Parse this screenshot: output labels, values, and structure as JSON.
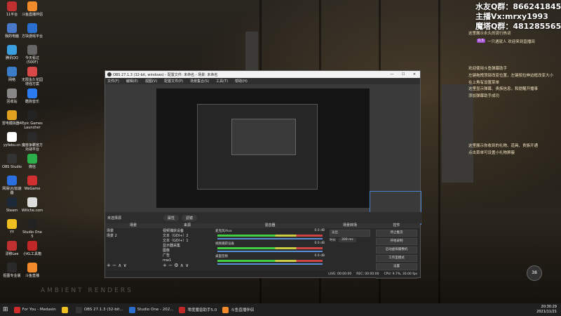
{
  "desktop_icons": [
    {
      "label": "11平台",
      "color": "#c03030"
    },
    {
      "label": "我的电脑",
      "color": "#4a78c8"
    },
    {
      "label": "腾讯QQ",
      "color": "#3aa0e0"
    },
    {
      "label": "网络",
      "color": "#3b7dc9"
    },
    {
      "label": "回收站",
      "color": "#888888"
    },
    {
      "label": "雷电模拟器4",
      "color": "#e0a020"
    },
    {
      "label": "yyfabu.cn",
      "color": "#ffffff"
    },
    {
      "label": "OBS Studio",
      "color": "#333333"
    },
    {
      "label": "网易UU加速器",
      "color": "#2b6ee0"
    },
    {
      "label": "Steam",
      "color": "#1b2838"
    },
    {
      "label": "YY",
      "color": "#f0c020"
    },
    {
      "label": "漂移Lee",
      "color": "#c03030"
    },
    {
      "label": "抠图专业版",
      "color": "#2a2a2a"
    },
    {
      "label": "斗鱼直播伴侣",
      "color": "#f08a2a"
    },
    {
      "label": "方块游戏平台",
      "color": "#2a6fd0"
    },
    {
      "label": "今天看过(500F)",
      "color": "#666666"
    },
    {
      "label": "无限永久花园增强方案",
      "color": "#d84848"
    },
    {
      "label": "酷狗音乐",
      "color": "#2a7cf0"
    },
    {
      "label": "Epic Games Launcher",
      "color": "#222222"
    },
    {
      "label": "魔兽争霸官方对战平台",
      "color": "#2a2a2a"
    },
    {
      "label": "微信",
      "color": "#2aaf4a"
    },
    {
      "label": "WeGame",
      "color": "#d03030"
    },
    {
      "label": "Wiliche.com",
      "color": "#dddddd"
    },
    {
      "label": "Studio One 5",
      "color": "#222222"
    },
    {
      "label": "小KL工具箱",
      "color": "#c02828"
    },
    {
      "label": "斗鱼直播",
      "color": "#f08a2a"
    }
  ],
  "overlay": {
    "line1": "水友Q群：866241845",
    "line2": "主播Vx:mrxy1993",
    "line3": "魔塔Q群：481285565",
    "chat": [
      "这里展示永久的流行热词",
      "一只遇就人  欢迎来到直播间",
      "欢迎使用斗鱼弹幕助手",
      "左键拖拽顶部改变位置，左键按拉伸边框改变大小",
      "在上角有设置菜单",
      "这里显示弹幕、贵族信息，和提醒开播事",
      "添加弹幕助手成功",
      "这里展示你收到的礼物、道具、贵族开通",
      "点击菜单可设置小礼物屏蔽"
    ],
    "badge": "0.5"
  },
  "obs": {
    "title": "OBS 27.1.3 (32-bit, windows) - 配置文件: 未命名 - 场景: 未命名",
    "menu": [
      "文件(F)",
      "编辑(E)",
      "视图(V)",
      "配置文件(P)",
      "场景集合(S)",
      "工具(T)",
      "帮助(H)"
    ],
    "preview_label": "未选择源",
    "properties_btn": "属性",
    "filters_btn": "滤镜",
    "docks": {
      "scenes": {
        "title": "场景",
        "items": [
          "场景",
          "场景 2"
        ]
      },
      "sources": {
        "title": "来源",
        "items": [
          "视频捕获设备",
          "文本（GDI+）2",
          "文本（GDI+）1",
          "显示器采集",
          "图像",
          "广告",
          "mw1"
        ]
      },
      "mixer": {
        "title": "混音器",
        "channels": [
          {
            "name": "麦克风/Aux",
            "level": "0.0 dB"
          },
          {
            "name": "视频捕获设备",
            "level": "0.0 dB"
          },
          {
            "name": "桌面音频",
            "level": "0.0 dB"
          }
        ]
      },
      "transitions": {
        "title": "场景转场",
        "type": "淡出",
        "duration_label": "时长",
        "duration": "300 ms"
      },
      "controls": {
        "title": "控件",
        "buttons": [
          "停止推流",
          "开始录制",
          "启动虚拟摄像机",
          "工作室模式",
          "设置",
          "退出"
        ]
      }
    },
    "status": {
      "live": "LIVE: 00:00:00",
      "rec": "REC: 00:00:00",
      "cpu": "CPU: 9.7%, 30.00 fps"
    }
  },
  "taskbar": {
    "items": [
      {
        "label": "For You - Medasin",
        "color": "#d02b2b"
      },
      {
        "label": "",
        "color": "#f0c020"
      },
      {
        "label": "OBS 27.1.3 (32-bit...",
        "color": "#333333"
      },
      {
        "label": "Studio One - 202...",
        "color": "#2a6fd0"
      },
      {
        "label": "零度魔兽助手5.0",
        "color": "#c02828"
      },
      {
        "label": "斗鱼直播伴侣",
        "color": "#f08a2a"
      }
    ],
    "time": "20:30:29",
    "date": "2021/11/21"
  },
  "watermark": "AMBIENT RENDERS",
  "speed": "38"
}
